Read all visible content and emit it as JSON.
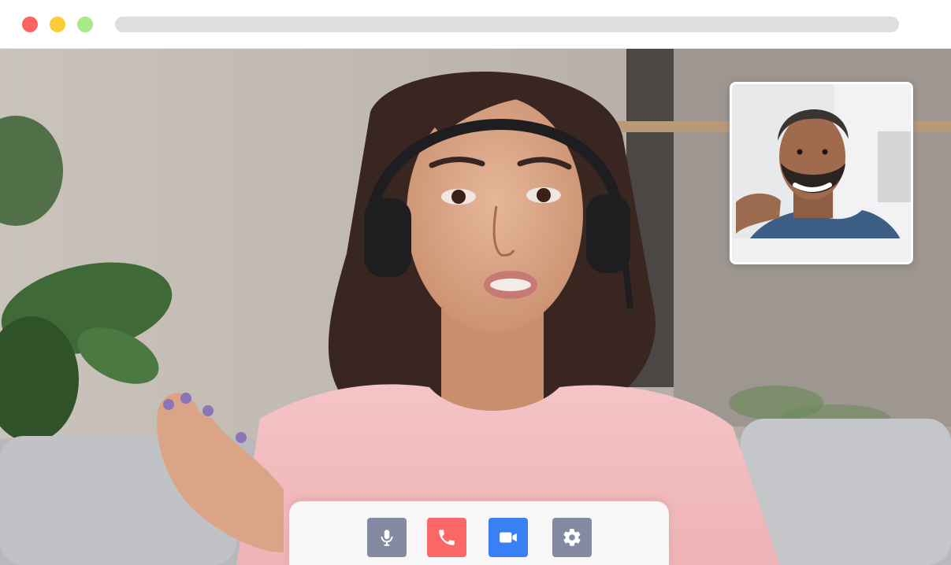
{
  "window": {
    "traffic_lights": {
      "close": "#fd6363",
      "minimize": "#fdcc34",
      "maximize": "#a8ea8a"
    },
    "address_bar_color": "#dedede"
  },
  "call": {
    "main_participant": {
      "description_icon": "presenter-video"
    },
    "self_view": {
      "description_icon": "self-video"
    }
  },
  "controls": {
    "mute": {
      "icon": "microphone-icon",
      "color": "#848aa1"
    },
    "end_call": {
      "icon": "phone-icon",
      "color": "#fb6666"
    },
    "camera": {
      "icon": "video-camera-icon",
      "color": "#3980f5"
    },
    "settings": {
      "icon": "gear-icon",
      "color": "#848aa1"
    }
  }
}
